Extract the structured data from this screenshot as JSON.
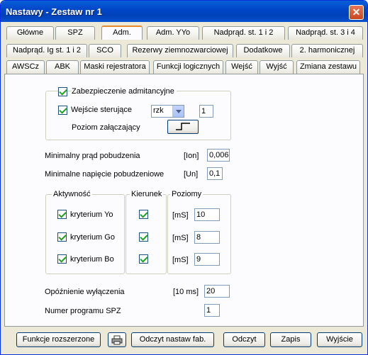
{
  "window": {
    "title": "Nastawy  -  Zestaw nr 1",
    "close": "✕"
  },
  "tabs": {
    "row1": [
      "Główne",
      "SPZ",
      "Adm.",
      "Adm. YYo",
      "Nadprąd. st. 1 i 2",
      "Nadprąd. st. 3 i 4"
    ],
    "row2": [
      "Nadprąd. Ig st. 1 i 2",
      "SCO",
      "Rezerwy ziemnozwarciowej",
      "Dodatkowe",
      "2. harmonicznej"
    ],
    "row3": [
      "AWSCz",
      "ABK",
      "Maski rejestratora",
      "Funkcji logicznych",
      "Wejść",
      "Wyjść",
      "Zmiana zestawu"
    ],
    "active": "Adm."
  },
  "admittance": {
    "group_label": "Zabezpieczenie admitancyjne",
    "checked": true,
    "input_label": "Wejście sterujące",
    "input_checked": true,
    "input_select": "rzk",
    "input_value": "1",
    "level_label": "Poziom załączający"
  },
  "params": {
    "min_current_label": "Minimalny prąd pobudzenia",
    "min_current_unit": "[Ion]",
    "min_current_value": "0,006",
    "min_voltage_label": "Minimalne napięcie pobudzeniowe",
    "min_voltage_unit": "[Un]",
    "min_voltage_value": "0,1"
  },
  "activity": {
    "label": "Aktywność",
    "items": [
      "kryterium Yo",
      "kryterium Go",
      "kryterium Bo"
    ]
  },
  "direction": {
    "label": "Kierunek"
  },
  "levels": {
    "label": "Poziomy",
    "unit": "[mS]",
    "values": [
      "10",
      "8",
      "9"
    ]
  },
  "delay": {
    "label": "Opóźnienie wyłączenia",
    "unit": "[10 ms]",
    "value": "20"
  },
  "spz_program": {
    "label": "Numer programu SPZ",
    "value": "1"
  },
  "buttons": {
    "extended": "Funkcje rozszerzone",
    "read_factory": "Odczyt nastaw fab.",
    "read": "Odczyt",
    "save": "Zapis",
    "exit": "Wyjście"
  }
}
